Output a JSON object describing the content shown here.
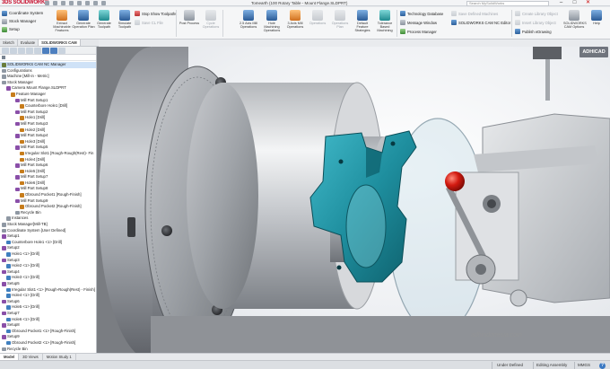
{
  "app": {
    "logo_brand": "3DS",
    "logo_text": "SOLIDWORKS",
    "window_title": "Tomearth (100 Rotary Table - Mount Flange.SLDPRT)",
    "search_placeholder": "Search MySolidWorks",
    "window_controls": [
      "–",
      "□",
      "✕"
    ],
    "brand_colors": {
      "solidworks_red": "#c8102e",
      "accent_blue": "#3a78c2",
      "part_teal": "#1e8e9e"
    }
  },
  "ribbon": {
    "left_items": [
      "Coordinate System",
      "Stock Manager",
      "Setup"
    ],
    "buttons": [
      "Extract Machinable Features",
      "Generate Operation Plan",
      "Generate Toolpath",
      "Simulate Toolpath",
      "Post Process",
      "Cycle Operations",
      "2.5 Axis Mill Operations",
      "Hole Machining Operations",
      "3 Axis Mill Operations",
      "Operations",
      "Operations Plan",
      "Default Feature Strategies",
      "Tolerance Based Machining"
    ],
    "mid_items": [
      "Stop Show Toolpaths",
      "Save CL File"
    ],
    "right_items": [
      "Technology Database",
      "Message Window",
      "Process Manager"
    ],
    "far_right_items": [
      "Save Defined Machines",
      "SOLIDWORKS CAM NC Editor"
    ],
    "right_column_items": [
      "Create Library Object",
      "Insert Library Object",
      "Publish eDrawing"
    ],
    "cam_options_label": "SOLIDWORKS CAM Options",
    "help_label": "Help"
  },
  "overlay_badge": "ADHICAD",
  "command_tabs": [
    "Sketch",
    "Evaluate",
    "SOLIDWORKS CAM"
  ],
  "tree": {
    "items": [
      {
        "label": "SOLIDWORKS CAM NC Manager",
        "icon": "cnc",
        "indent": 0,
        "hl": true
      },
      {
        "label": "Configurations",
        "icon": "misc",
        "indent": 0
      },
      {
        "label": "Machine [Mill-in - Metric]",
        "icon": "misc",
        "indent": 0
      },
      {
        "label": "Stock Manager",
        "icon": "misc",
        "indent": 0
      },
      {
        "label": "Camera Mount Flange.SLDPRT",
        "icon": "set",
        "indent": 1
      },
      {
        "label": "Feature Manager",
        "icon": "feat",
        "indent": 2
      },
      {
        "label": "Mill Part Setup1",
        "icon": "set",
        "indent": 3
      },
      {
        "label": "Counterbore Hole1 [Drill]",
        "icon": "feat",
        "indent": 4
      },
      {
        "label": "Mill Part Setup2",
        "icon": "set",
        "indent": 3
      },
      {
        "label": "Hole1 [Drill]",
        "icon": "feat",
        "indent": 4
      },
      {
        "label": "Mill Part Setup3",
        "icon": "set",
        "indent": 3
      },
      {
        "label": "Hole2 [Drill]",
        "icon": "feat",
        "indent": 4
      },
      {
        "label": "Mill Part Setup4",
        "icon": "set",
        "indent": 3
      },
      {
        "label": "Hole3 [Drill]",
        "icon": "feat",
        "indent": 4
      },
      {
        "label": "Mill Part Setup5",
        "icon": "set",
        "indent": 3
      },
      {
        "label": "Irregular Slot1 [Rough-Rough(Rest)- Fin",
        "icon": "feat",
        "indent": 4
      },
      {
        "label": "Hole4 [Drill]",
        "icon": "feat",
        "indent": 4
      },
      {
        "label": "Mill Part Setup6",
        "icon": "set",
        "indent": 3
      },
      {
        "label": "Hole5 [Drill]",
        "icon": "feat",
        "indent": 4
      },
      {
        "label": "Mill Part Setup7",
        "icon": "set",
        "indent": 3
      },
      {
        "label": "Hole6 [Drill]",
        "icon": "feat",
        "indent": 4
      },
      {
        "label": "Mill Part Setup8",
        "icon": "set",
        "indent": 3
      },
      {
        "label": "Obround Pocket1 [Rough-Finish]",
        "icon": "feat",
        "indent": 4
      },
      {
        "label": "Mill Part Setup9",
        "icon": "set",
        "indent": 3
      },
      {
        "label": "Obround Pocket2 [Rough-Finish]",
        "icon": "feat",
        "indent": 4
      },
      {
        "label": "Recycle Bin",
        "icon": "misc",
        "indent": 3
      },
      {
        "label": "Instances",
        "icon": "misc",
        "indent": 1
      },
      {
        "label": "Stock Manager[Mill-TB]",
        "icon": "misc",
        "indent": 0
      },
      {
        "label": "Coordinate System [User Defined]",
        "icon": "misc",
        "indent": 0
      },
      {
        "label": "Setup1",
        "icon": "set",
        "indent": 0
      },
      {
        "label": "Counterbore Hole1 <1> [Drill]",
        "icon": "op",
        "indent": 1
      },
      {
        "label": "Setup2",
        "icon": "set",
        "indent": 0
      },
      {
        "label": "Hole1 <1> [Drill]",
        "icon": "op",
        "indent": 1
      },
      {
        "label": "Setup3",
        "icon": "set",
        "indent": 0
      },
      {
        "label": "Hole2 <1> [Drill]",
        "icon": "op",
        "indent": 1
      },
      {
        "label": "Setup4",
        "icon": "set",
        "indent": 0
      },
      {
        "label": "Hole3 <1> [Drill]",
        "icon": "op",
        "indent": 1
      },
      {
        "label": "Setup5",
        "icon": "set",
        "indent": 0
      },
      {
        "label": "Irregular Slot1 <1> [Rough-Rough(Rest) - Finish]",
        "icon": "op",
        "indent": 1
      },
      {
        "label": "Hole4 <1> [Drill]",
        "icon": "op",
        "indent": 1
      },
      {
        "label": "Setup6",
        "icon": "set",
        "indent": 0
      },
      {
        "label": "Hole5 <1> [Drill]",
        "icon": "op",
        "indent": 1
      },
      {
        "label": "Setup7",
        "icon": "set",
        "indent": 0
      },
      {
        "label": "Hole6 <1> [Drill]",
        "icon": "op",
        "indent": 1
      },
      {
        "label": "Setup8",
        "icon": "set",
        "indent": 0
      },
      {
        "label": "Obround Pocket1 <1> [Rough-Finish]",
        "icon": "op",
        "indent": 1
      },
      {
        "label": "Setup9",
        "icon": "set",
        "indent": 0
      },
      {
        "label": "Obround Pocket2 <1> [Rough-Finish]",
        "icon": "op",
        "indent": 1
      },
      {
        "label": "Recycle Bin",
        "icon": "misc",
        "indent": 0
      }
    ]
  },
  "bottom_tabs": [
    "Model",
    "3D Views",
    "Motion Study 1"
  ],
  "status": {
    "left": "",
    "under_defined": "Under Defined",
    "editing": "Editing Assembly",
    "units": "MMGS"
  },
  "watermark": "adhindonesia.com"
}
